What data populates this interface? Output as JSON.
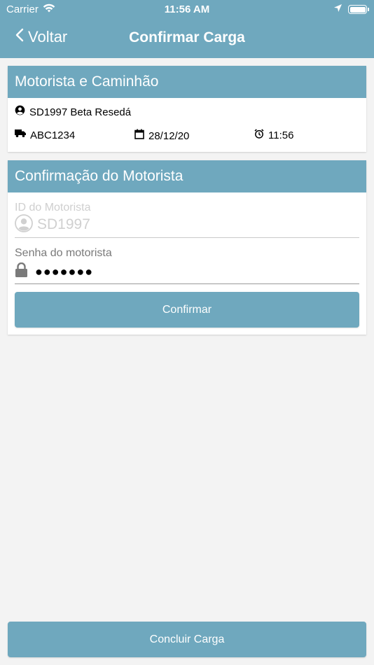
{
  "status_bar": {
    "carrier": "Carrier",
    "time": "11:56 AM"
  },
  "nav": {
    "back_label": "Voltar",
    "title": "Confirmar Carga"
  },
  "driver_card": {
    "header": "Motorista e Caminhão",
    "driver": "SD1997 Beta Resedá",
    "plate": "ABC1234",
    "date": "28/12/20",
    "time": "11:56"
  },
  "confirm_card": {
    "header": "Confirmação do Motorista",
    "id_label": "ID do Motorista",
    "id_value": "SD1997",
    "password_label": "Senha do motorista",
    "password_value": "●●●●●●●",
    "confirm_button": "Confirmar"
  },
  "footer": {
    "finish_button": "Concluir Carga"
  },
  "colors": {
    "accent": "#6fa8be",
    "background": "#f3f3f3"
  }
}
